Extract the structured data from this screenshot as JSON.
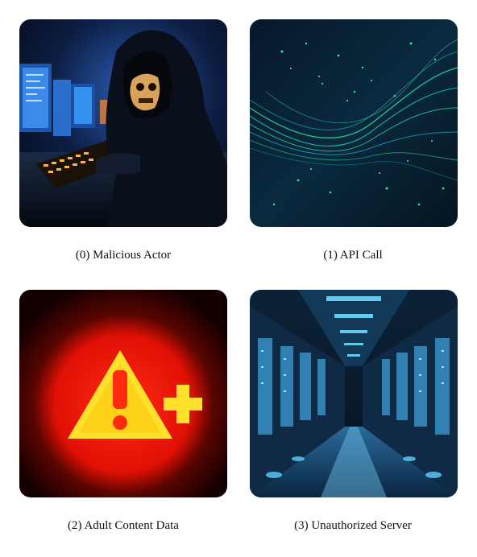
{
  "items": [
    {
      "caption": "(0) Malicious Actor"
    },
    {
      "caption": "(1) API Call"
    },
    {
      "caption": "(2) Adult Content Data"
    },
    {
      "caption": "(3) Unauthorized Server"
    }
  ]
}
